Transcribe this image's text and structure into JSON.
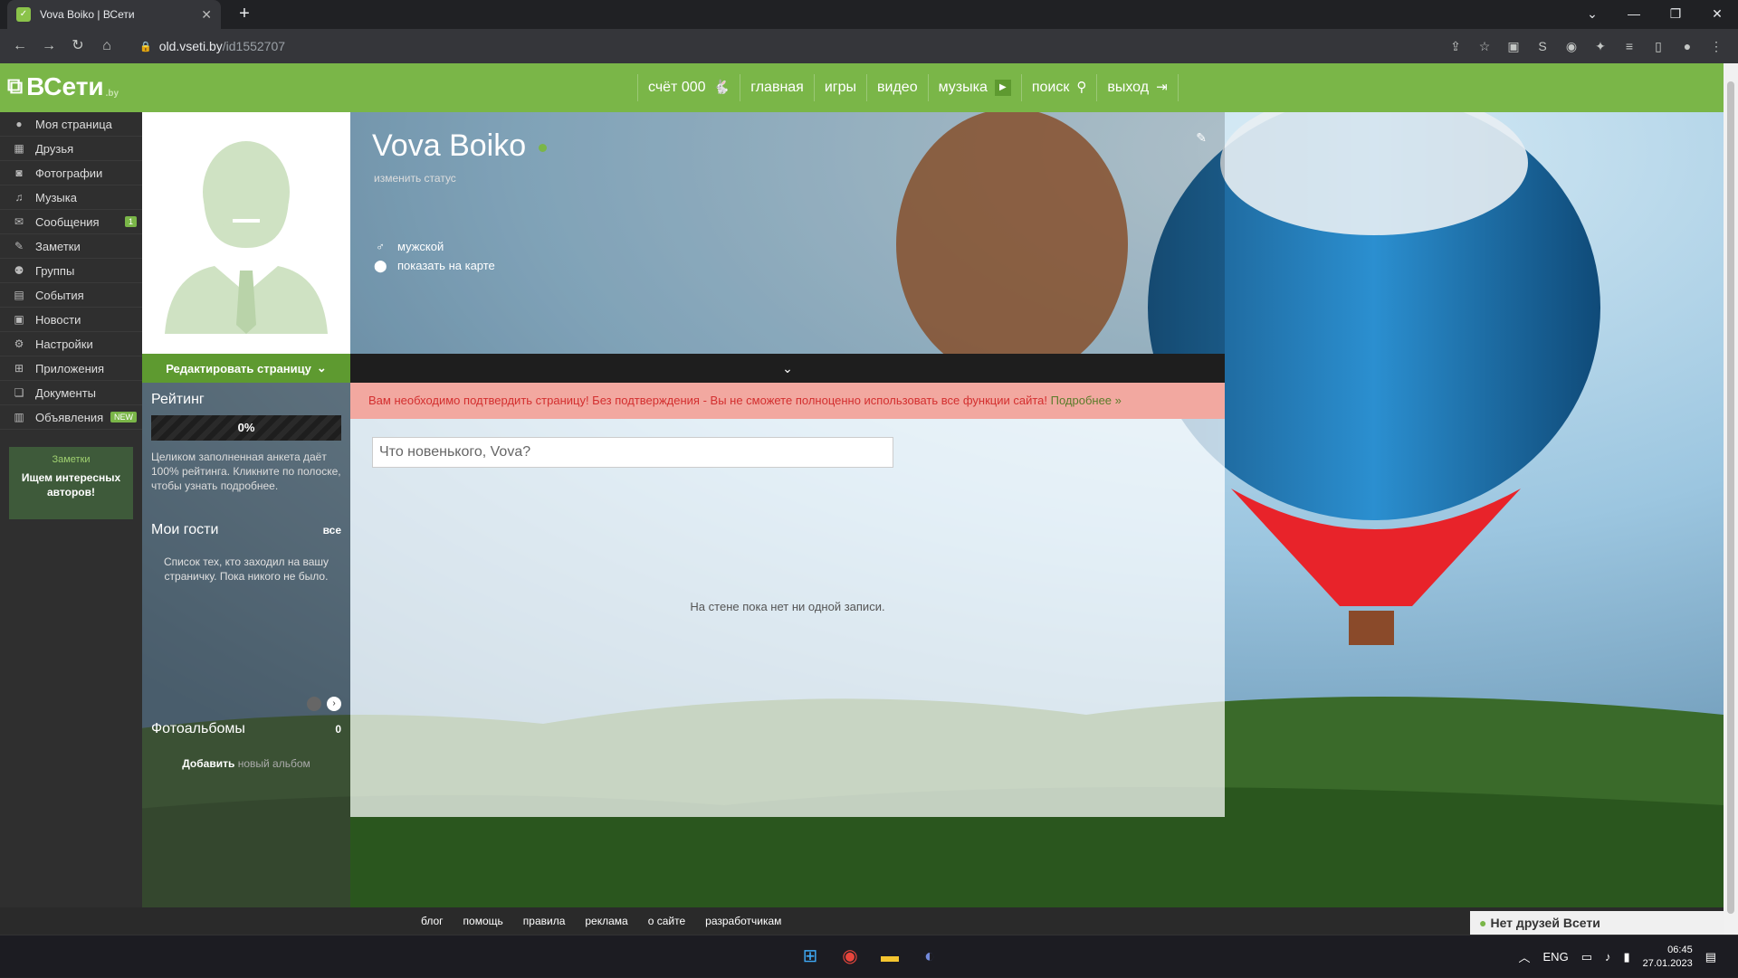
{
  "browser": {
    "tab_title": "Vova Boiko | ВСети",
    "url_host": "old.vseti.by",
    "url_path": "/id1552707"
  },
  "site": {
    "logo_text": "ВСети",
    "logo_suffix": ".by",
    "top_nav": [
      {
        "label": "счёт 000",
        "icon": "rabbit-icon"
      },
      {
        "label": "главная"
      },
      {
        "label": "игры"
      },
      {
        "label": "видео"
      },
      {
        "label": "музыка",
        "icon": "play-icon"
      },
      {
        "label": "поиск",
        "icon": "search-icon"
      },
      {
        "label": "выход",
        "icon": "logout-icon"
      }
    ],
    "accent": "#7ab648"
  },
  "sidebar": {
    "items": [
      {
        "label": "Моя страница",
        "icon": "user-icon"
      },
      {
        "label": "Друзья",
        "icon": "friends-icon"
      },
      {
        "label": "Фотографии",
        "icon": "camera-icon"
      },
      {
        "label": "Музыка",
        "icon": "music-icon"
      },
      {
        "label": "Сообщения",
        "icon": "mail-icon",
        "badge": "1"
      },
      {
        "label": "Заметки",
        "icon": "note-icon"
      },
      {
        "label": "Группы",
        "icon": "group-icon"
      },
      {
        "label": "События",
        "icon": "calendar-icon"
      },
      {
        "label": "Новости",
        "icon": "news-icon"
      },
      {
        "label": "Настройки",
        "icon": "gear-icon"
      },
      {
        "label": "Приложения",
        "icon": "apps-icon"
      },
      {
        "label": "Документы",
        "icon": "book-icon"
      },
      {
        "label": "Объявления",
        "icon": "ads-icon",
        "badge": "NEW"
      }
    ],
    "notes_box": {
      "heading": "Заметки",
      "text": "Ищем интересных авторов!"
    }
  },
  "left_column": {
    "edit_button": "Редактировать страницу",
    "rating": {
      "title": "Рейтинг",
      "value": "0%",
      "hint": "Целиком заполненная анкета даёт 100% рейтинга. Кликните по полоске, чтобы узнать подробнее."
    },
    "guests": {
      "title": "Мои гости",
      "all_link": "все",
      "empty": "Список тех, кто заходил на вашу страничку. Пока никого не было."
    },
    "albums": {
      "title": "Фотоальбомы",
      "count": "0",
      "add_link": "Добавить",
      "add_hint": "новый альбом"
    }
  },
  "profile": {
    "name": "Vova Boiko",
    "status_link": "изменить статус",
    "gender": "мужской",
    "map_link": "показать на карте"
  },
  "alert": {
    "text": "Вам необходимо подтвердить страницу! Без подтверждения - Вы не сможете полноценно использовать все функции сайта!",
    "more": "Подробнее »"
  },
  "wall": {
    "placeholder": "Что новенького, Vova?",
    "empty": "На стене пока нет ни одной записи."
  },
  "footer": {
    "links": [
      "блог",
      "помощь",
      "правила",
      "реклама",
      "о сайте",
      "разработчикам"
    ],
    "friends_panel": "Нет друзей Всети"
  },
  "taskbar": {
    "lang": "ENG",
    "time": "06:45",
    "date": "27.01.2023"
  }
}
